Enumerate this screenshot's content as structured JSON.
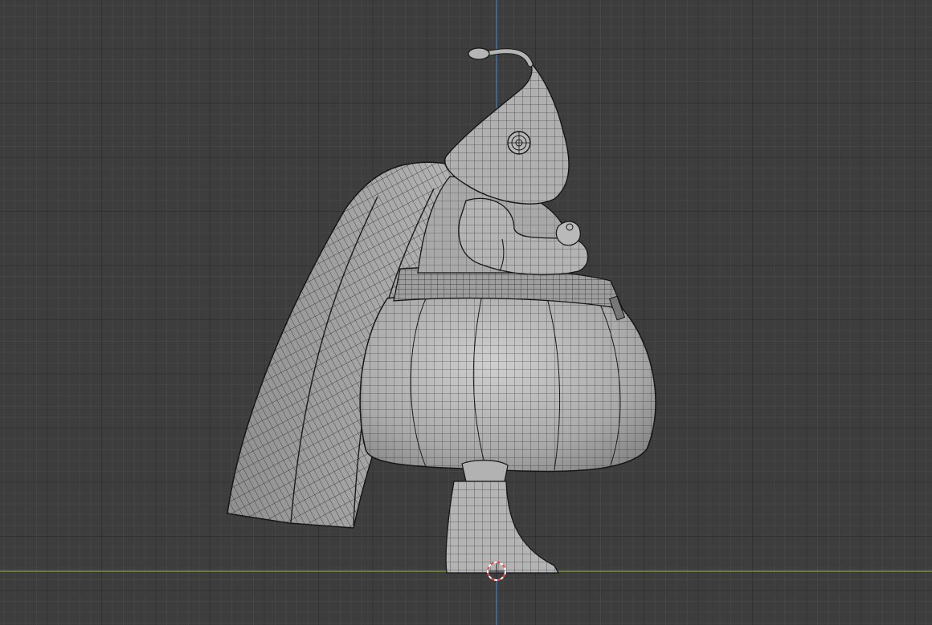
{
  "app": "3D viewport",
  "viewport": {
    "mode": "wireframe-overlay",
    "view": "side",
    "background_color": "#3d3d3d",
    "grid_color": "#2a2a2a",
    "axis_x_color": "#7ea142",
    "axis_z_color": "#3f80c6",
    "cursor_colors": [
      "#e34b4b",
      "#ffffff"
    ]
  },
  "model": {
    "type": "character mesh",
    "parts": [
      "antenna",
      "head",
      "eye",
      "cape",
      "arm",
      "hand",
      "belt",
      "pants",
      "boot"
    ],
    "surface_color": "#b3b3b3",
    "wire_color": "#1a1a1a"
  },
  "icons": {
    "cursor": "3d-cursor-icon"
  }
}
